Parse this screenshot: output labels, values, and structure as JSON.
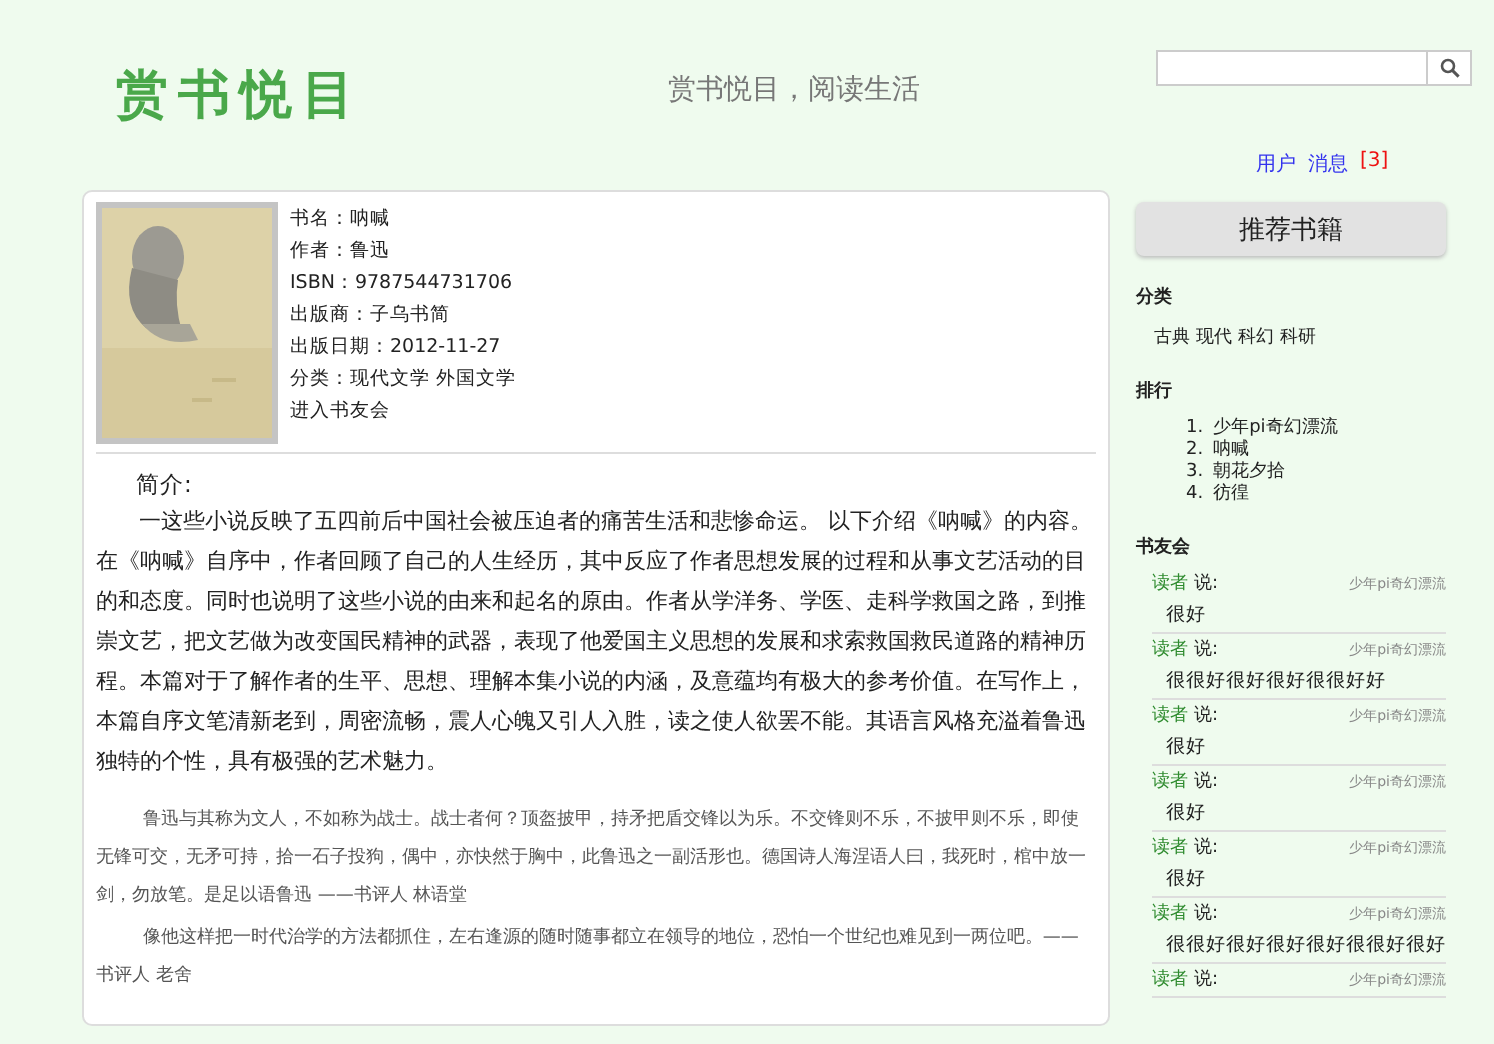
{
  "header": {
    "logo": "赏书悦目",
    "tagline": "赏书悦目，阅读生活",
    "links": [
      {
        "kind": "link",
        "label": "用户"
      },
      {
        "kind": "link",
        "label": "消息"
      },
      {
        "kind": "count",
        "label": "[3]"
      }
    ]
  },
  "book": {
    "cover": {
      "kind": "picture"
    },
    "info": [
      "书名：呐喊",
      "作者：鲁迅",
      "ISBN：9787544731706",
      "出版商：子乌书简",
      "出版日期：2012-11-27",
      "分类：现代文学 外国文学"
    ],
    "club_link": "进入书友会",
    "intro_title": "简介:",
    "intro": "一这些小说反映了五四前后中国社会被压迫者的痛苦生活和悲惨命运。 以下介绍《呐喊》的内容。在《呐喊》自序中，作者回顾了自己的人生经历，其中反应了作者思想发展的过程和从事文艺活动的目的和态度。同时也说明了这些小说的由来和起名的原由。作者从学洋务、学医、走科学救国之路，到推崇文艺，把文艺做为改变国民精神的武器，表现了他爱国主义思想的发展和求索救国救民道路的精神历程。本篇对于了解作者的生平、思想、理解本集小说的内涵，及意蕴均有极大的参考价值。在写作上，本篇自序文笔清新老到，周密流畅，震人心魄又引人入胜，读之使人欲罢不能。其语言风格充溢着鲁迅独特的个性，具有极强的艺术魅力。",
    "reviews": [
      "鲁迅与其称为文人，不如称为战士。战士者何？顶盔披甲，持矛把盾交锋以为乐。不交锋则不乐，不披甲则不乐，即使无锋可交，无矛可持，拾一石子投狗，偶中，亦快然于胸中，此鲁迅之一副活形也。德国诗人海涅语人曰，我死时，棺中放一剑，勿放笔。是足以语鲁迅 ——书评人 林语堂",
      "像他这样把一时代治学的方法都抓住，左右逢源的随时随事都立在领导的地位，恐怕一个世纪也难见到一两位吧。——书评人 老舍"
    ]
  },
  "sidebar": {
    "title": "推荐书籍",
    "categories": {
      "heading": "分类",
      "items": [
        "古典",
        "现代",
        "科幻",
        "科研"
      ]
    },
    "ranking": {
      "heading": "排行",
      "items": [
        {
          "number": "1.",
          "label": "少年pi奇幻漂流"
        },
        {
          "number": "2.",
          "label": "呐喊"
        },
        {
          "number": "3.",
          "label": "朝花夕拾"
        },
        {
          "number": "4.",
          "label": "彷徨"
        }
      ]
    },
    "club": {
      "heading": "书友会",
      "comments": [
        {
          "user": "读者",
          "says": "说:",
          "book": "少年pi奇幻漂流",
          "text": "很好"
        },
        {
          "user": "读者",
          "says": "说:",
          "book": "少年pi奇幻漂流",
          "text": "很很好很好很好很很好好"
        },
        {
          "user": "读者",
          "says": "说:",
          "book": "少年pi奇幻漂流",
          "text": "很好"
        },
        {
          "user": "读者",
          "says": "说:",
          "book": "少年pi奇幻漂流",
          "text": "很好"
        },
        {
          "user": "读者",
          "says": "说:",
          "book": "少年pi奇幻漂流",
          "text": "很好"
        },
        {
          "user": "读者",
          "says": "说:",
          "book": "少年pi奇幻漂流",
          "text": "很很好很好很好很好很很好很好"
        },
        {
          "user": "读者",
          "says": "说:",
          "book": "少年pi奇幻漂流"
        }
      ]
    }
  }
}
